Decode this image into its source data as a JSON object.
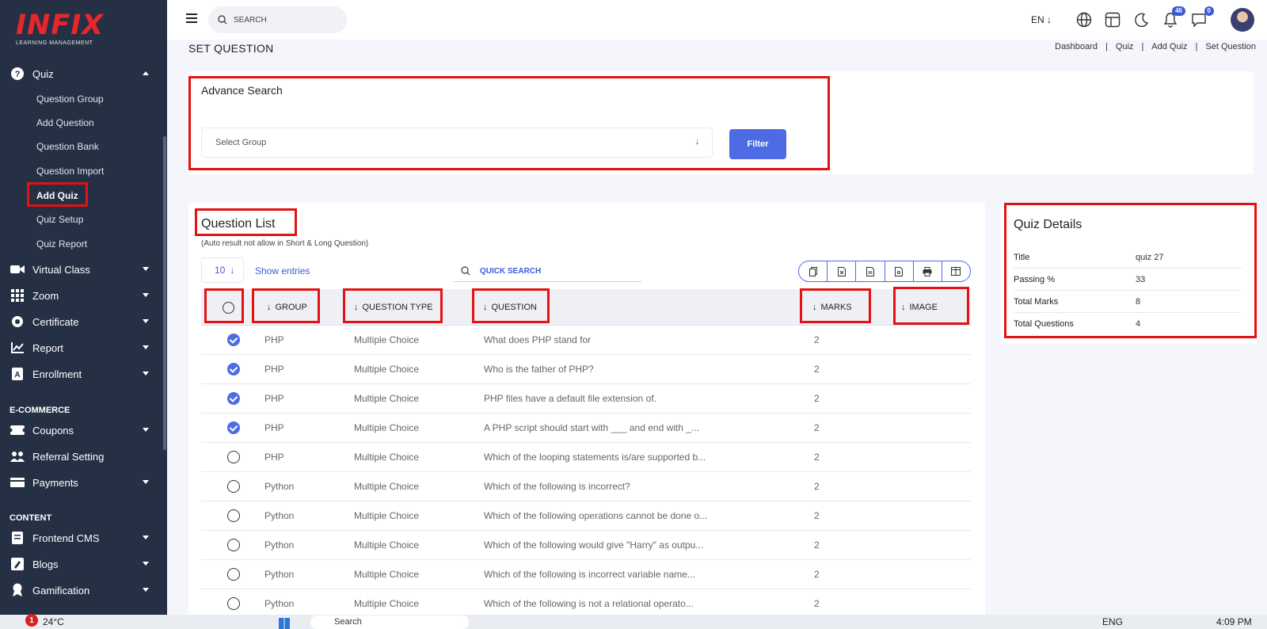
{
  "app": {
    "logo_main": "INFIX",
    "logo_sub": "LEARNING MANAGEMENT"
  },
  "sidebar": {
    "quiz": {
      "label": "Quiz",
      "icon": "question-circle-icon"
    },
    "quiz_sub": [
      {
        "label": "Question Group"
      },
      {
        "label": "Add Question"
      },
      {
        "label": "Question Bank"
      },
      {
        "label": "Question Import"
      },
      {
        "label": "Add Quiz",
        "active": true
      },
      {
        "label": "Quiz Setup"
      },
      {
        "label": "Quiz Report"
      }
    ],
    "items": [
      {
        "label": "Virtual Class",
        "icon": "virtual-class-icon"
      },
      {
        "label": "Zoom",
        "icon": "grid-icon"
      },
      {
        "label": "Certificate",
        "icon": "certificate-icon"
      },
      {
        "label": "Report",
        "icon": "chart-icon"
      },
      {
        "label": "Enrollment",
        "icon": "enrollment-icon"
      }
    ],
    "section_ecommerce": "E-COMMERCE",
    "ecommerce_items": [
      {
        "label": "Coupons",
        "icon": "coupon-icon"
      },
      {
        "label": "Referral Setting",
        "icon": "referral-icon"
      },
      {
        "label": "Payments",
        "icon": "payment-icon"
      }
    ],
    "section_content": "CONTENT",
    "content_items": [
      {
        "label": "Frontend CMS",
        "icon": "cms-icon"
      },
      {
        "label": "Blogs",
        "icon": "blog-icon"
      },
      {
        "label": "Gamification",
        "icon": "gamification-icon"
      }
    ]
  },
  "topbar": {
    "search_placeholder": "SEARCH",
    "language": "EN",
    "notifications_count": "46",
    "messages_count": "0"
  },
  "page": {
    "title": "SET QUESTION",
    "breadcrumb": [
      "Dashboard",
      "Quiz",
      "Add Quiz",
      "Set Question"
    ]
  },
  "advance_search": {
    "title": "Advance Search",
    "select_placeholder": "Select Group",
    "filter_label": "Filter"
  },
  "question_list": {
    "title": "Question List",
    "note": "(Auto result not allow in Short & Long Question)",
    "entries_value": "10",
    "entries_label": "Show entries",
    "quick_search": "QUICK SEARCH",
    "columns": [
      "GROUP",
      "QUESTION TYPE",
      "QUESTION",
      "MARKS",
      "IMAGE"
    ],
    "rows": [
      {
        "checked": true,
        "group": "PHP",
        "type": "Multiple Choice",
        "question": "What does PHP stand for",
        "marks": "2"
      },
      {
        "checked": true,
        "group": "PHP",
        "type": "Multiple Choice",
        "question": "Who is the father of PHP?",
        "marks": "2"
      },
      {
        "checked": true,
        "group": "PHP",
        "type": "Multiple Choice",
        "question": "PHP files have a default file extension of.",
        "marks": "2"
      },
      {
        "checked": true,
        "group": "PHP",
        "type": "Multiple Choice",
        "question": "A PHP script should start with ___ and end with _...",
        "marks": "2"
      },
      {
        "checked": false,
        "group": "PHP",
        "type": "Multiple Choice",
        "question": "Which of the looping statements is/are supported b...",
        "marks": "2"
      },
      {
        "checked": false,
        "group": "Python",
        "type": "Multiple Choice",
        "question": "Which of the following is incorrect?",
        "marks": "2"
      },
      {
        "checked": false,
        "group": "Python",
        "type": "Multiple Choice",
        "question": "Which of the following operations cannot be done o...",
        "marks": "2"
      },
      {
        "checked": false,
        "group": "Python",
        "type": "Multiple Choice",
        "question": "Which of the following would give \"Harry\" as outpu...",
        "marks": "2"
      },
      {
        "checked": false,
        "group": "Python",
        "type": "Multiple Choice",
        "question": "Which of the following is incorrect variable name...",
        "marks": "2"
      },
      {
        "checked": false,
        "group": "Python",
        "type": "Multiple Choice",
        "question": "Which of the following is not a relational operato...",
        "marks": "2"
      }
    ]
  },
  "quiz_details": {
    "title": "Quiz Details",
    "rows": [
      {
        "key": "Title",
        "value": "quiz 27"
      },
      {
        "key": "Passing %",
        "value": "33"
      },
      {
        "key": "Total Marks",
        "value": "8"
      },
      {
        "key": "Total Questions",
        "value": "4"
      }
    ]
  },
  "taskbar": {
    "weather_badge": "1",
    "weather": "24°C",
    "search": "Search",
    "lang": "ENG",
    "time": "4:09 PM"
  },
  "colors": {
    "sidebar_bg": "#253044",
    "accent": "#4d6be3",
    "logo_red": "#e8262b",
    "annotation_red": "#e41212"
  }
}
